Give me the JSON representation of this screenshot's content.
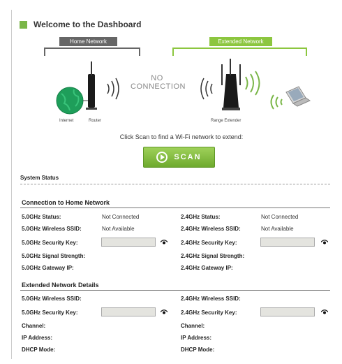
{
  "dashboard": {
    "title": "Welcome to the Dashboard",
    "home_network_label": "Home Network",
    "extended_network_label": "Extended Network",
    "internet_label": "Internet",
    "router_label": "Router",
    "range_extender_label": "Range Extender",
    "no_connection": "NO CONNECTION",
    "scan_prompt": "Click Scan to find a Wi-Fi network to extend:",
    "scan_button": "SCAN",
    "accent_color": "#8cc63f"
  },
  "system_status": {
    "heading": "System Status",
    "connection_heading": "Connection to Home Network",
    "extended_heading": "Extended Network Details",
    "conn_left": {
      "status_label": "5.0GHz Status:",
      "status_value": "Not Connected",
      "ssid_label": "5.0GHz Wireless SSID:",
      "ssid_value": "Not Available",
      "key_label": "5.0GHz Security Key:",
      "signal_label": "5.0GHz Signal Strength:",
      "gateway_label": "5.0GHz Gateway IP:"
    },
    "conn_right": {
      "status_label": "2.4GHz Status:",
      "status_value": "Not Connected",
      "ssid_label": "2.4GHz Wireless SSID:",
      "ssid_value": "Not Available",
      "key_label": "2.4GHz Security Key:",
      "signal_label": "2.4GHz Signal Strength:",
      "gateway_label": "2.4GHz Gateway IP:"
    },
    "ext_left": {
      "ssid_label": "5.0GHz Wireless SSID:",
      "key_label": "5.0GHz Security Key:",
      "channel_label": "Channel:",
      "ip_label": "IP Address:",
      "dhcp_label": "DHCP Mode:"
    },
    "ext_right": {
      "ssid_label": "2.4GHz Wireless SSID:",
      "key_label": "2.4GHz Security Key:",
      "channel_label": "Channel:",
      "ip_label": "IP Address:",
      "dhcp_label": "DHCP Mode:"
    }
  }
}
